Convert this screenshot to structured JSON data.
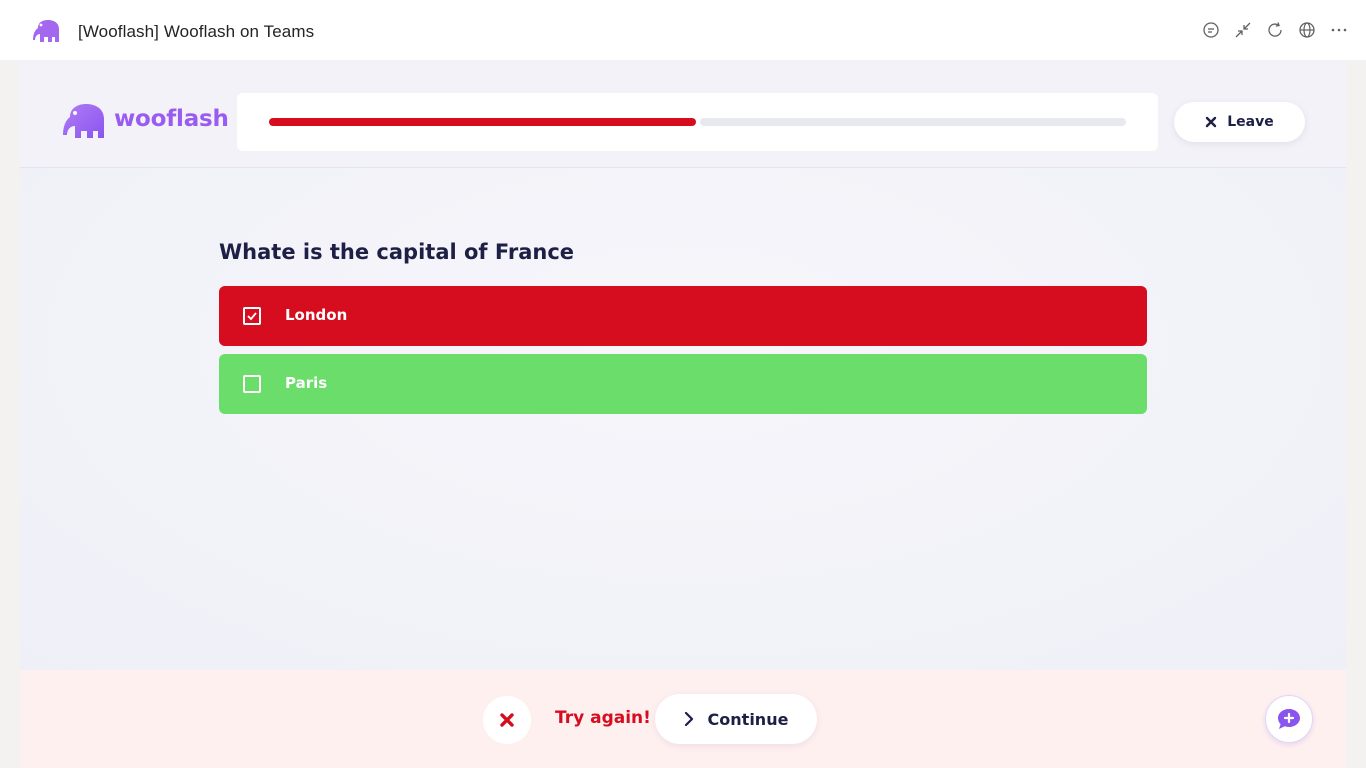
{
  "teams_header": {
    "title": "[Wooflash] Wooflash on Teams",
    "icons": [
      "chat-icon",
      "minimize-icon",
      "refresh-icon",
      "globe-icon",
      "more-icon"
    ]
  },
  "app": {
    "brand": "wooflash",
    "brand_color": "#9a5cf0",
    "progress_fraction": 0.5,
    "leave_label": "Leave"
  },
  "question": {
    "text": "Whate is the capital of France",
    "answers": [
      {
        "label": "London",
        "status": "wrong",
        "checked": true,
        "color": "#d50d1f"
      },
      {
        "label": "Paris",
        "status": "correct",
        "checked": false,
        "color": "#6bdd6b"
      }
    ]
  },
  "feedback": {
    "message": "Try again!",
    "continue_label": "Continue",
    "status_color": "#d50d1f"
  }
}
